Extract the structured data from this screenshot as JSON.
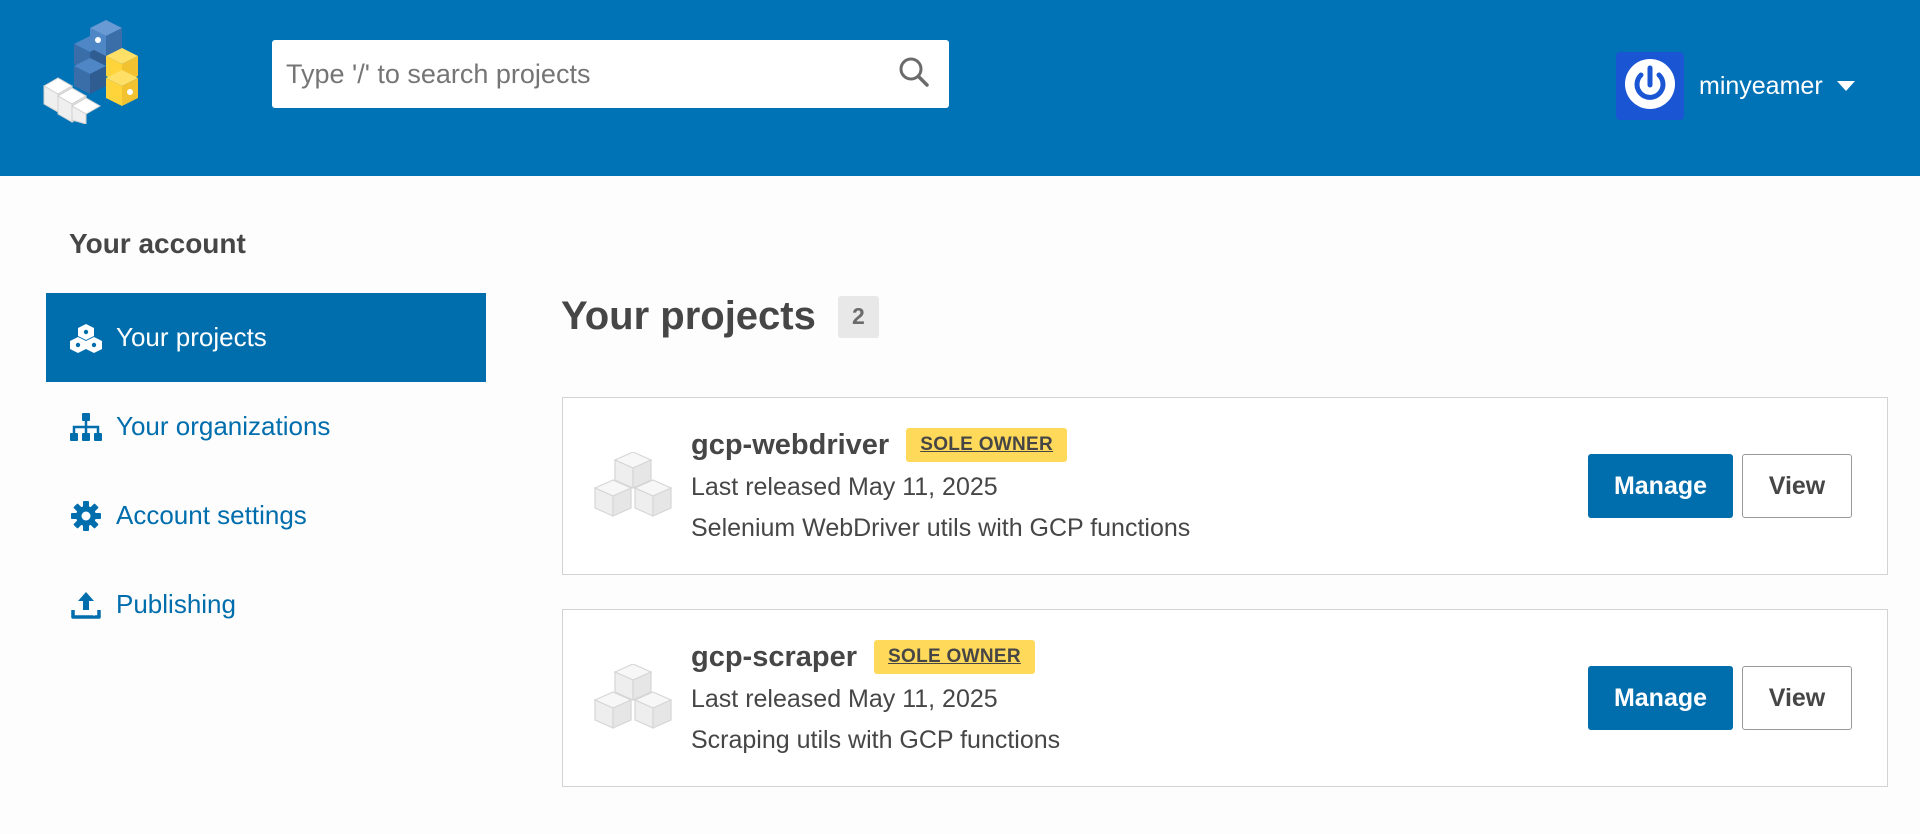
{
  "header": {
    "logo_icon": "pypi-logo-icon",
    "search": {
      "placeholder": "Type '/' to search projects",
      "value": "",
      "icon": "search-icon"
    },
    "user": {
      "name": "minyeamer",
      "avatar_icon": "power-icon",
      "avatar_color": "#1a55d3"
    },
    "colors": {
      "brand": "#0073b7"
    }
  },
  "sidebar": {
    "heading": "Your account",
    "items": [
      {
        "label": "Your projects",
        "icon": "cubes-icon",
        "active": true
      },
      {
        "label": "Your organizations",
        "icon": "sitemap-icon",
        "active": false
      },
      {
        "label": "Account settings",
        "icon": "gear-icon",
        "active": false
      },
      {
        "label": "Publishing",
        "icon": "upload-icon",
        "active": false
      }
    ]
  },
  "main": {
    "title": "Your projects",
    "count": "2",
    "projects": [
      {
        "name": "gcp-webdriver",
        "role": "SOLE OWNER",
        "released": "Last released May 11, 2025",
        "description": "Selenium WebDriver utils with GCP functions",
        "manage_label": "Manage",
        "view_label": "View"
      },
      {
        "name": "gcp-scraper",
        "role": "SOLE OWNER",
        "released": "Last released May 11, 2025",
        "description": "Scraping utils with GCP functions",
        "manage_label": "Manage",
        "view_label": "View"
      }
    ]
  }
}
